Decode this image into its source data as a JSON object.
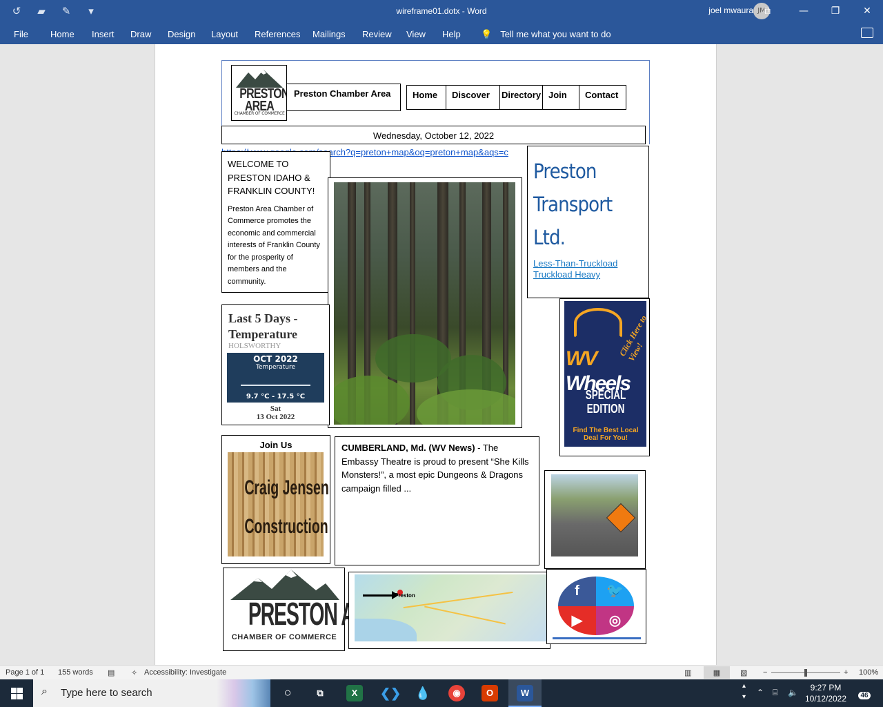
{
  "titlebar": {
    "doc_title": "wireframe01.dotx  -  Word",
    "user_name": "joel mwaura",
    "user_initials": "JM"
  },
  "ribbon": {
    "tabs": [
      "File",
      "Home",
      "Insert",
      "Draw",
      "Design",
      "Layout",
      "References",
      "Mailings",
      "Review",
      "View",
      "Help"
    ],
    "tell_me": "Tell me what you want to do"
  },
  "doc": {
    "chamber_title": "Preston Chamber Area",
    "logo": {
      "name": "PRESTON AREA",
      "sub": "CHAMBER OF COMMERCE"
    },
    "nav": [
      "Home",
      "Discover",
      "Directory",
      "Join",
      "Contact"
    ],
    "date": "Wednesday, October 12, 2022",
    "url": "https://www.google.com/search?q=preton+map&oq=preton+map&aqs=c",
    "welcome": {
      "title": "WELCOME TO PRESTON IDAHO & FRANKLIN COUNTY!",
      "body": "Preston Area Chamber of Commerce promotes the economic and commercial interests of Franklin County for the prosperity of members and the community."
    },
    "transport": {
      "title_lines": [
        "Preston",
        "Transport",
        "Ltd."
      ],
      "links": "Less-Than-Truckload  Truckload  Heavy"
    },
    "temperature": {
      "title": "Last 5 Days - Temperature",
      "location": "HOLSWORTHY",
      "month": "OCT 2022",
      "label": "Temperature",
      "range": "9.7 °C - 17.5 °C",
      "day": "Sat",
      "date": "13 Oct 2022"
    },
    "wheels_ad": {
      "click": "Click Here to View!",
      "wv": "WV",
      "wheels": "Wheels",
      "special": "SPECIAL EDITION",
      "deal": "Find The Best Local Deal For You!"
    },
    "join": {
      "title": "Join Us",
      "img_text_1": "Craig Jensen",
      "img_text_2": "Construction"
    },
    "news": {
      "lead": "CUMBERLAND, Md. (WV News)",
      "body": " - The Embassy Theatre is proud to present “She Kills Monsters!”, a most epic Dungeons & Dragons campaign filled ..."
    },
    "map_label": "Preston",
    "colors": {
      "brand_blue": "#2b579a",
      "link_blue": "#1155cc",
      "transport_blue": "#1f5aa0"
    }
  },
  "statusbar": {
    "page": "Page 1 of 1",
    "words": "155 words",
    "accessibility": "Accessibility: Investigate",
    "zoom": "100%"
  },
  "taskbar": {
    "search_placeholder": "Type here to search",
    "time": "9:27 PM",
    "date": "10/12/2022",
    "notifications": "46"
  }
}
